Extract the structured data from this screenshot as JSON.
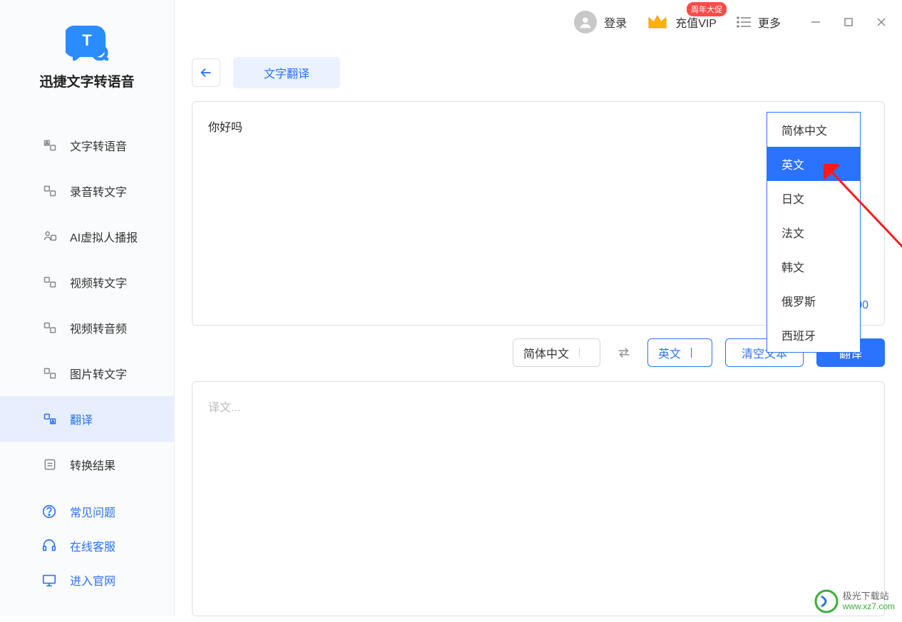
{
  "app": {
    "title": "迅捷文字转语音"
  },
  "sidebar": {
    "items": [
      {
        "label": "文字转语音"
      },
      {
        "label": "录音转文字"
      },
      {
        "label": "AI虚拟人播报"
      },
      {
        "label": "视频转文字"
      },
      {
        "label": "视频转音频"
      },
      {
        "label": "图片转文字"
      },
      {
        "label": "翻译"
      },
      {
        "label": "转换结果"
      }
    ],
    "help": [
      {
        "label": "常见问题"
      },
      {
        "label": "在线客服"
      },
      {
        "label": "进入官网"
      }
    ]
  },
  "titlebar": {
    "login": "登录",
    "vip": "充值VIP",
    "promo": "周年大促",
    "more": "更多"
  },
  "tabs": {
    "translate": "文字翻译"
  },
  "input": {
    "text": "你好吗",
    "count": "3 / 100"
  },
  "controls": {
    "source": "简体中文",
    "target": "英文",
    "clear": "清空文本",
    "translate": "翻译"
  },
  "output": {
    "placeholder": "译文..."
  },
  "dropdown": {
    "options": [
      {
        "label": "简体中文"
      },
      {
        "label": "英文"
      },
      {
        "label": "日文"
      },
      {
        "label": "法文"
      },
      {
        "label": "韩文"
      },
      {
        "label": "俄罗斯"
      },
      {
        "label": "西班牙"
      }
    ],
    "selected_index": 1
  },
  "watermark": {
    "name": "极光下载站",
    "url": "www.xz7.com"
  }
}
